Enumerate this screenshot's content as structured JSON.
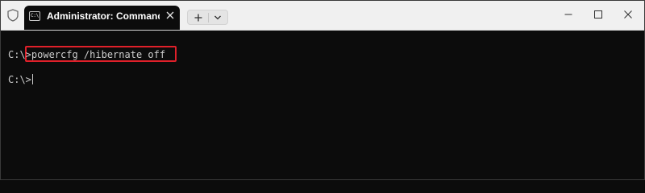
{
  "window": {
    "tab_title": "Administrator: Command Pro",
    "tab_icon_text": "C:\\",
    "icons": {
      "shield": "shield-icon",
      "tab": "cmd-icon",
      "tab_close": "close-icon",
      "new_tab": "plus-icon",
      "dropdown": "chevron-down-icon",
      "minimize": "minimize-icon",
      "maximize": "maximize-icon",
      "close": "close-icon"
    }
  },
  "terminal": {
    "lines": [
      {
        "prompt": "C:\\>",
        "command": "powercfg /hibernate off"
      },
      {
        "prompt": "C:\\>",
        "command": ""
      }
    ]
  },
  "colors": {
    "terminal_bg": "#0c0c0c",
    "terminal_text": "#cccccc",
    "titlebar_bg": "#f0f0f0",
    "highlight": "#e0202a"
  }
}
